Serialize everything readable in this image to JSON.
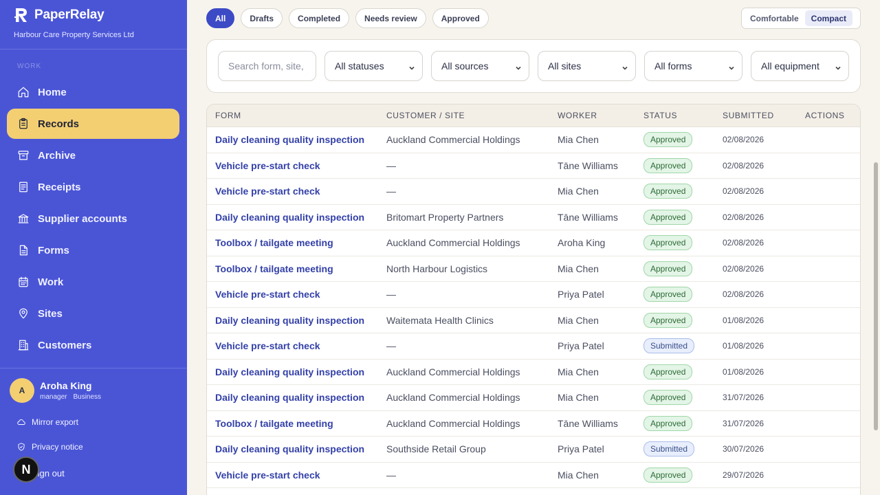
{
  "brand": {
    "name": "PaperRelay",
    "company": "Harbour Care Property Services Ltd"
  },
  "sidebar": {
    "section_label": "WORK",
    "items": [
      {
        "label": "Home",
        "icon": "home-icon"
      },
      {
        "label": "Records",
        "icon": "clipboard-icon",
        "active": true
      },
      {
        "label": "Archive",
        "icon": "archive-icon"
      },
      {
        "label": "Receipts",
        "icon": "receipt-icon"
      },
      {
        "label": "Supplier accounts",
        "icon": "bank-icon"
      },
      {
        "label": "Forms",
        "icon": "form-icon"
      },
      {
        "label": "Work",
        "icon": "calendar-icon"
      },
      {
        "label": "Sites",
        "icon": "map-pin-icon"
      },
      {
        "label": "Customers",
        "icon": "building-icon"
      }
    ],
    "user": {
      "initial": "A",
      "name": "Aroha King",
      "role": "manager",
      "plan": "Business"
    },
    "links": {
      "mirror_export": "Mirror export",
      "privacy": "Privacy notice",
      "sign_out": "Sign out"
    },
    "n_badge": "N"
  },
  "tabs": [
    "All",
    "Drafts",
    "Completed",
    "Needs review",
    "Approved"
  ],
  "density": {
    "comfortable": "Comfortable",
    "compact": "Compact"
  },
  "filters": {
    "search_placeholder": "Search form, site,",
    "status": "All statuses",
    "source": "All sources",
    "site": "All sites",
    "form": "All forms",
    "equipment": "All equipment"
  },
  "table": {
    "headers": {
      "form": "FORM",
      "customer": "CUSTOMER / SITE",
      "worker": "WORKER",
      "status": "STATUS",
      "submitted": "SUBMITTED",
      "actions": "ACTIONS"
    },
    "rows": [
      {
        "form": "Daily cleaning quality inspection",
        "customer": "Auckland Commercial Holdings",
        "worker": "Mia Chen",
        "status": "Approved",
        "submitted": "02/08/2026"
      },
      {
        "form": "Vehicle pre-start check",
        "customer": "—",
        "worker": "Tāne Williams",
        "status": "Approved",
        "submitted": "02/08/2026"
      },
      {
        "form": "Vehicle pre-start check",
        "customer": "—",
        "worker": "Mia Chen",
        "status": "Approved",
        "submitted": "02/08/2026"
      },
      {
        "form": "Daily cleaning quality inspection",
        "customer": "Britomart Property Partners",
        "worker": "Tāne Williams",
        "status": "Approved",
        "submitted": "02/08/2026"
      },
      {
        "form": "Toolbox / tailgate meeting",
        "customer": "Auckland Commercial Holdings",
        "worker": "Aroha King",
        "status": "Approved",
        "submitted": "02/08/2026"
      },
      {
        "form": "Toolbox / tailgate meeting",
        "customer": "North Harbour Logistics",
        "worker": "Mia Chen",
        "status": "Approved",
        "submitted": "02/08/2026"
      },
      {
        "form": "Vehicle pre-start check",
        "customer": "—",
        "worker": "Priya Patel",
        "status": "Approved",
        "submitted": "02/08/2026"
      },
      {
        "form": "Daily cleaning quality inspection",
        "customer": "Waitemata Health Clinics",
        "worker": "Mia Chen",
        "status": "Approved",
        "submitted": "01/08/2026"
      },
      {
        "form": "Vehicle pre-start check",
        "customer": "—",
        "worker": "Priya Patel",
        "status": "Submitted",
        "submitted": "01/08/2026"
      },
      {
        "form": "Daily cleaning quality inspection",
        "customer": "Auckland Commercial Holdings",
        "worker": "Mia Chen",
        "status": "Approved",
        "submitted": "01/08/2026"
      },
      {
        "form": "Daily cleaning quality inspection",
        "customer": "Auckland Commercial Holdings",
        "worker": "Mia Chen",
        "status": "Approved",
        "submitted": "31/07/2026"
      },
      {
        "form": "Toolbox / tailgate meeting",
        "customer": "Auckland Commercial Holdings",
        "worker": "Tāne Williams",
        "status": "Approved",
        "submitted": "31/07/2026"
      },
      {
        "form": "Daily cleaning quality inspection",
        "customer": "Southside Retail Group",
        "worker": "Priya Patel",
        "status": "Submitted",
        "submitted": "30/07/2026"
      },
      {
        "form": "Vehicle pre-start check",
        "customer": "—",
        "worker": "Mia Chen",
        "status": "Approved",
        "submitted": "29/07/2026"
      }
    ]
  },
  "colors": {
    "sidebar": "#4a55d6",
    "active_nav": "#f3cf72",
    "accent": "#3d4ac6",
    "approved": "#2d6a37",
    "submitted": "#3a4e8a"
  }
}
